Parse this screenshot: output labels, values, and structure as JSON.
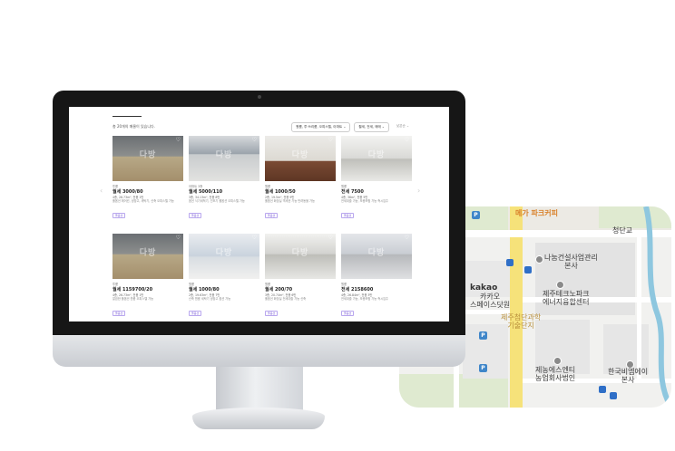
{
  "screen": {
    "result_count": "총 20개의 매물이 있습니다.",
    "filters": [
      {
        "label": "원룸, 투·쓰리룸, 오피스텔, 아파트 ⌄"
      },
      {
        "label": "월세, 전세, 매매 ⌄"
      },
      {
        "label": "낮은순 ⌄"
      }
    ],
    "listings": [
      {
        "tag": "투룸",
        "price": "월세 3000/80",
        "spec": "4층, 26.73m², 전용 1만",
        "desc": "풀옵션 에어컨, 냉장고, 세탁기, 신축 오피스텔 가능",
        "badge": "풀옵션",
        "photo": "room1"
      },
      {
        "tag": "아파트 3층",
        "price": "월세 5000/110",
        "spec": "3층, 34.13m², 전용 8만",
        "desc": "옵션 식기세척기, 건조기 풀옵션 오피스텔 가능",
        "badge": "풀옵션",
        "photo": "room2"
      },
      {
        "tag": "원룸",
        "price": "월세 1000/50",
        "spec": "2층, 19.5m², 전용 9만",
        "desc": "풀옵션 화장실 역세권 가능 반려동물 가능",
        "badge": "풀옵션",
        "photo": "room3"
      },
      {
        "tag": "원룸",
        "price": "전세 7500",
        "spec": "4층, 36m², 전용 5만",
        "desc": "전세대출 가능, 보증보험 가능 즉시입주",
        "badge": "풀옵션",
        "photo": "room4"
      },
      {
        "tag": "투룸",
        "price": "월세 1159700/20",
        "spec": "4층, 26.73m², 전용 1만",
        "desc": "깔끔한 풀옵션 원룸 오피스텔 가능",
        "badge": "풀옵션",
        "photo": "room1"
      },
      {
        "tag": "원룸",
        "price": "월세 1000/80",
        "spec": "2층, 19.63m², 전용 7만",
        "desc": "신축 원룸 세탁기 냉장고 옵션 가능",
        "badge": "풀옵션",
        "photo": "room5"
      },
      {
        "tag": "원룸",
        "price": "월세 200/70",
        "spec": "3층, 20.74m², 전용 6만",
        "desc": "풀옵션 화장실 전세대출 가능 신축",
        "badge": "풀옵션",
        "photo": "room6"
      },
      {
        "tag": "원룸",
        "price": "전세 2158600",
        "spec": "4층, 26.84m², 전용 3만",
        "desc": "전세대출 가능, 보증보험 가능 즉시입주",
        "badge": "풀옵션",
        "photo": "room7"
      }
    ]
  },
  "map": {
    "labels": {
      "cafe": "메가 파크커피",
      "bridge": "청단교",
      "building1": "나눔건설사업관리\n본사",
      "building2": "제주테크노파크\n에너지융합센터",
      "kakao_brand": "kakao",
      "kakao_name": "카카오\n스페이스닷원",
      "complex": "제주첨단과학\n기술단지",
      "building3": "제농에스엔티\n농업회사법인",
      "building4": "한국비엠에이\n본사"
    }
  }
}
